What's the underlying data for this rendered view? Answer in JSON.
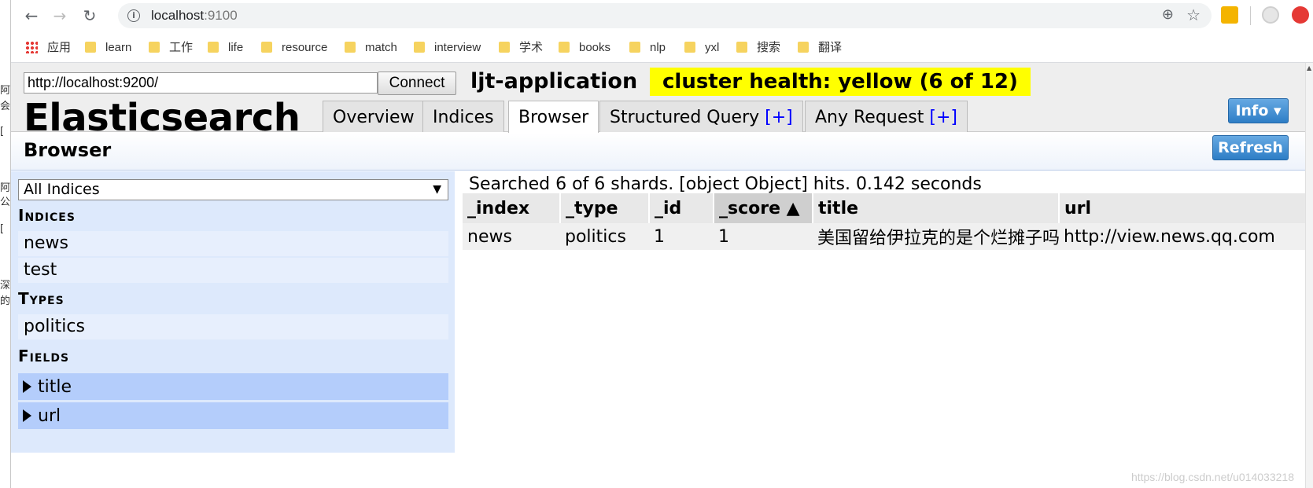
{
  "left_window": {
    "glyphs": [
      "阿",
      "会",
      "[",
      "阿",
      "公",
      "[",
      "深",
      "的"
    ]
  },
  "browser": {
    "url_host": "localhost",
    "url_port": ":9100",
    "bookmarks": [
      {
        "label": "应用",
        "icon": "apps-grid-icon"
      },
      {
        "label": "learn",
        "icon": "folder-icon"
      },
      {
        "label": "工作",
        "icon": "folder-icon"
      },
      {
        "label": "life",
        "icon": "folder-icon"
      },
      {
        "label": "resource",
        "icon": "folder-icon"
      },
      {
        "label": "match",
        "icon": "folder-icon"
      },
      {
        "label": "interview",
        "icon": "folder-icon"
      },
      {
        "label": "学术",
        "icon": "folder-icon"
      },
      {
        "label": "books",
        "icon": "folder-icon"
      },
      {
        "label": "nlp",
        "icon": "folder-icon"
      },
      {
        "label": "yxl",
        "icon": "folder-icon"
      },
      {
        "label": "搜索",
        "icon": "folder-icon"
      },
      {
        "label": "翻译",
        "icon": "folder-icon"
      }
    ]
  },
  "header": {
    "cluster_url": "http://localhost:9200/",
    "connect_label": "Connect",
    "cluster_name": "ljt-application",
    "cluster_health": "cluster health: yellow (6 of 12)",
    "brand": "Elasticsearch",
    "info_label": "Info ▾",
    "colors": {
      "health": "#ffff00",
      "button": "#2e7ec6"
    }
  },
  "tabs": [
    {
      "label": "Overview",
      "plus": ""
    },
    {
      "label": "Indices",
      "plus": ""
    },
    {
      "label": "Browser",
      "plus": ""
    },
    {
      "label": "Structured Query ",
      "plus": "[+]"
    },
    {
      "label": "Any Request ",
      "plus": "[+]"
    }
  ],
  "browser_panel": {
    "title": "Browser",
    "refresh_label": "Refresh",
    "index_select": "All Indices",
    "indices_title": "Indices",
    "indices": [
      "news",
      "test"
    ],
    "types_title": "Types",
    "types": [
      "politics"
    ],
    "fields_title": "Fields",
    "fields": [
      "title",
      "url"
    ]
  },
  "results": {
    "summary": "Searched 6 of 6 shards. [object Object] hits. 0.142 seconds",
    "columns": [
      "_index",
      "_type",
      "_id",
      "_score ▲",
      "title",
      "url"
    ],
    "rows": [
      [
        "news",
        "politics",
        "1",
        "1",
        "美国留给伊拉克的是个烂摊子吗",
        "http://view.news.qq.com"
      ]
    ]
  },
  "watermark": "https://blog.csdn.net/u014033218"
}
